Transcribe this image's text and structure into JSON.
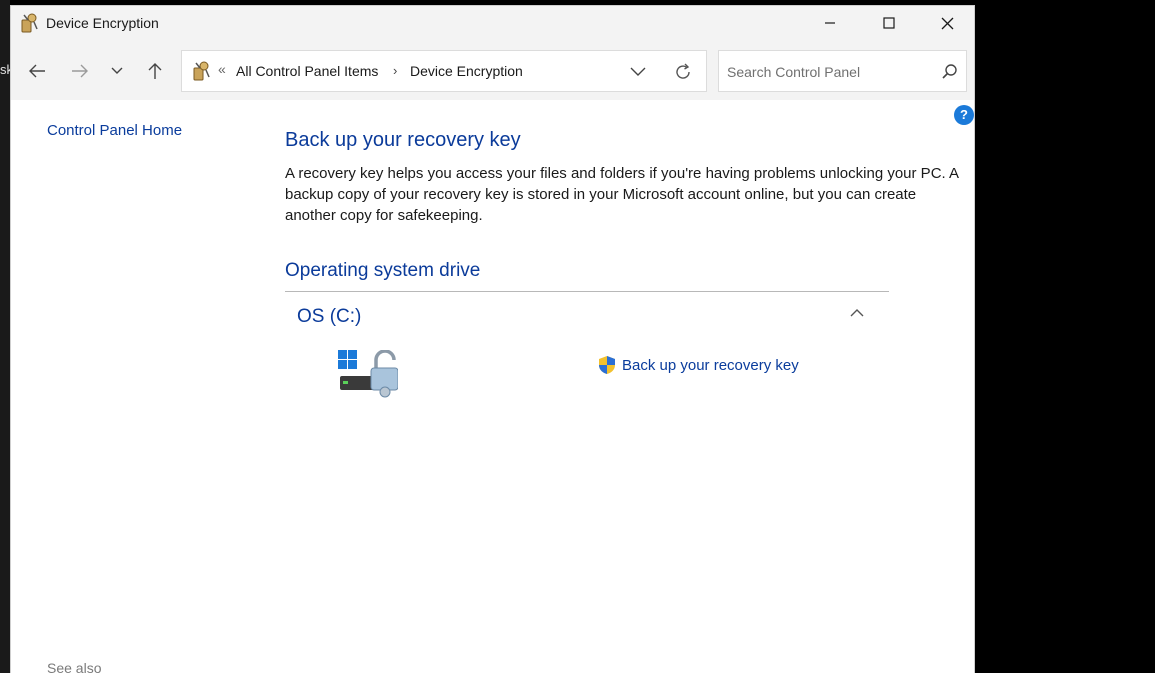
{
  "desktop": {
    "edge_text": "sk"
  },
  "window": {
    "title": "Device Encryption",
    "controls": {
      "minimize": "minimize",
      "maximize": "maximize",
      "close": "close"
    }
  },
  "nav": {
    "address": {
      "separator": "«",
      "crumbs": [
        "All Control Panel Items",
        "Device Encryption"
      ],
      "arrow": "›"
    },
    "search": {
      "placeholder": "Search Control Panel"
    },
    "help": "?"
  },
  "left_pane": {
    "home_link": "Control Panel Home",
    "see_also": "See also"
  },
  "main": {
    "heading": "Back up your recovery key",
    "description": "A recovery key helps you access your files and folders if you're having problems unlocking your PC. A backup copy of your recovery key is stored in your Microsoft account online, but you can create another copy for safekeeping.",
    "section_title": "Operating system drive",
    "drive": {
      "name": "OS (C:)",
      "action_link": "Back up your recovery key"
    }
  },
  "colors": {
    "link": "#0a3c9c",
    "heading": "#0b3b9a",
    "chrome": "#f3f3f3",
    "help": "#1b7ad9"
  }
}
